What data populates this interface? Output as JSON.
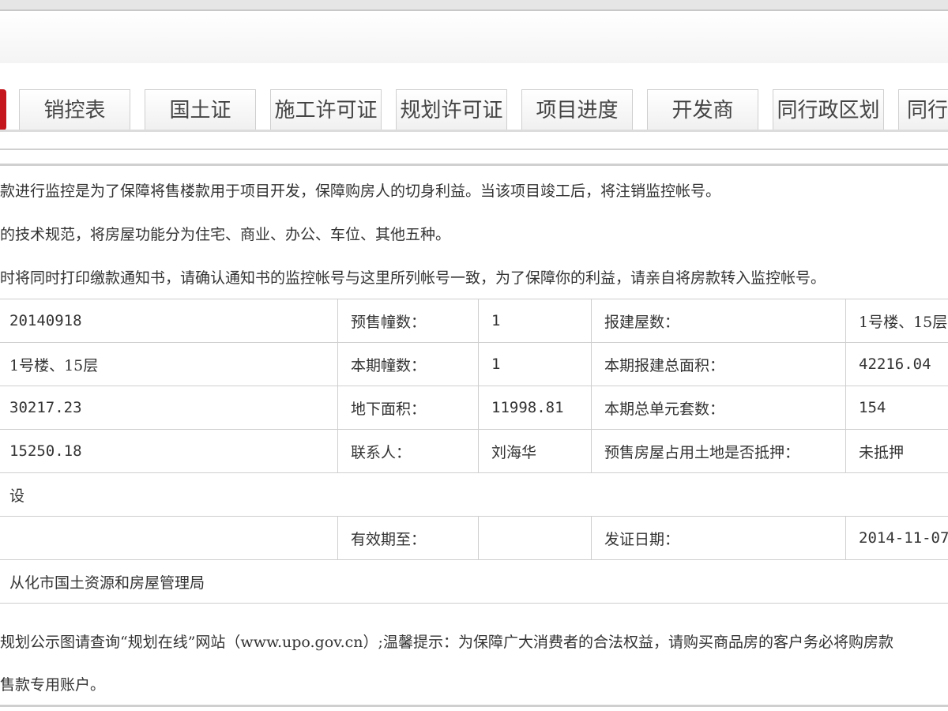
{
  "tabs": [
    {
      "label": "销控表"
    },
    {
      "label": "国土证"
    },
    {
      "label": "施工许可证"
    },
    {
      "label": "规划许可证"
    },
    {
      "label": "项目进度"
    },
    {
      "label": "开发商"
    },
    {
      "label": "同行政区划"
    },
    {
      "label": "同行政"
    }
  ],
  "notes": [
    "款进行监控是为了保障将售楼款用于项目开发，保障购房人的切身利益。当该项目竣工后，将注销监控帐号。",
    "的技术规范，将房屋功能分为住宅、商业、办公、车位、其他五种。",
    "时将同时打印缴款通知书，请确认通知书的监控帐号与这里所列帐号一致，为了保障你的利益，请亲自将房款转入监控帐号。"
  ],
  "table": {
    "r1": {
      "c1": "20140918",
      "c2": "预售幢数：",
      "c3": "1",
      "c4": "报建屋数：",
      "c5": "1号楼、15层"
    },
    "r2": {
      "c1": "1号楼、15层",
      "c2": "本期幢数：",
      "c3": "1",
      "c4": "本期报建总面积：",
      "c5": "42216.04"
    },
    "r3": {
      "c1": "30217.23",
      "c2": "地下面积：",
      "c3": "11998.81",
      "c4": "本期总单元套数：",
      "c5": "154"
    },
    "r4": {
      "c1": "15250.18",
      "c2": "联系人：",
      "c3": "刘海华",
      "c4": "预售房屋占用土地是否抵押：",
      "c5": "未抵押"
    },
    "r5": {
      "c1": "设"
    },
    "r6": {
      "c1": "",
      "c2": "有效期至：",
      "c3": "",
      "c4": "发证日期：",
      "c5": "2014-11-07"
    },
    "r7": {
      "c1": "从化市国土资源和房屋管理局"
    }
  },
  "footer": {
    "line1": "规划公示图请查询“规划在线”网站（www.upo.gov.cn）;温馨提示：为保障广大消费者的合法权益，请购买商品房的客户务必将购房款",
    "line2": "售款专用账户。"
  }
}
